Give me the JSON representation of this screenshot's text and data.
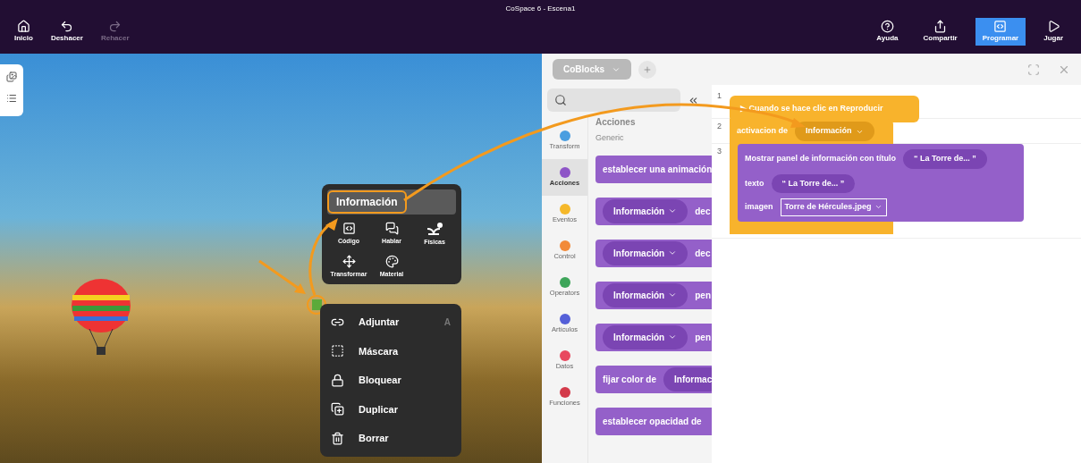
{
  "window": {
    "title": "CoSpace 6 - Escena1"
  },
  "toolbar_left": [
    {
      "kind": "home",
      "label": "Inicio",
      "disabled": false
    },
    {
      "kind": "undo",
      "label": "Deshacer",
      "disabled": false
    },
    {
      "kind": "redo",
      "label": "Rehacer",
      "disabled": true
    }
  ],
  "toolbar_right": [
    {
      "kind": "help",
      "label": "Ayuda",
      "selected": false
    },
    {
      "kind": "share",
      "label": "Compartir",
      "selected": false
    },
    {
      "kind": "code",
      "label": "Programar",
      "selected": true
    },
    {
      "kind": "play",
      "label": "Jugar",
      "selected": false
    }
  ],
  "context_menu": {
    "title": "Información",
    "tools": [
      {
        "kind": "code",
        "label": "Código"
      },
      {
        "kind": "speech",
        "label": "Hablar"
      },
      {
        "kind": "physics",
        "label": "Físicas"
      },
      {
        "kind": "move",
        "label": "Transformar"
      },
      {
        "kind": "palette",
        "label": "Material"
      }
    ],
    "actions": [
      {
        "kind": "attach",
        "label": "Adjuntar",
        "shortcut": "A"
      },
      {
        "kind": "mask",
        "label": "Máscara"
      },
      {
        "kind": "lock",
        "label": "Bloquear"
      },
      {
        "kind": "duplicate",
        "label": "Duplicar"
      },
      {
        "kind": "delete",
        "label": "Borrar"
      }
    ]
  },
  "code_panel": {
    "tab": "CoBlocks",
    "categories": [
      {
        "label": "Transform",
        "color": "#4a9ee0",
        "selected": false
      },
      {
        "label": "Acciones",
        "color": "#8e55c7",
        "selected": true
      },
      {
        "label": "Eventos",
        "color": "#f5b82a",
        "selected": false
      },
      {
        "label": "Control",
        "color": "#f28a38",
        "selected": false
      },
      {
        "label": "Operators",
        "color": "#3ea55a",
        "selected": false
      },
      {
        "label": "Artículos",
        "color": "#5560d8",
        "selected": false
      },
      {
        "label": "Datos",
        "color": "#e8485f",
        "selected": false
      },
      {
        "label": "Funciones",
        "color": "#d33a4a",
        "selected": false
      }
    ],
    "palette_heading": "Acciones",
    "palette_subheading": "Generic",
    "palette_blocks": [
      {
        "kind": "text",
        "text": "establecer una animación"
      },
      {
        "kind": "dropdown_first",
        "dropdown": "Información",
        "text": "dec"
      },
      {
        "kind": "dropdown_first",
        "dropdown": "Información",
        "text": "dec"
      },
      {
        "kind": "dropdown_first",
        "dropdown": "Información",
        "text": "pen"
      },
      {
        "kind": "dropdown_first",
        "dropdown": "Información",
        "text": "pen"
      },
      {
        "kind": "text_first",
        "text": "fijar color de",
        "dropdown": "Informac"
      },
      {
        "kind": "text",
        "text": "establecer opacidad de"
      }
    ],
    "lines": [
      {
        "number": "1"
      },
      {
        "number": "2"
      },
      {
        "number": "3"
      }
    ],
    "hat_block": "▶ Cuando se hace clic en Reproducir",
    "trigger_block": {
      "label": "activacion de",
      "dropdown": "Información"
    },
    "info_block": {
      "title_label": "Mostrar panel de información con título",
      "title_value": "“ La Torre de... ”",
      "text_label": "texto",
      "text_value": "“ La Torre de... ”",
      "image_label": "imagen",
      "image_value": "Torre de Hércules.jpeg"
    }
  }
}
